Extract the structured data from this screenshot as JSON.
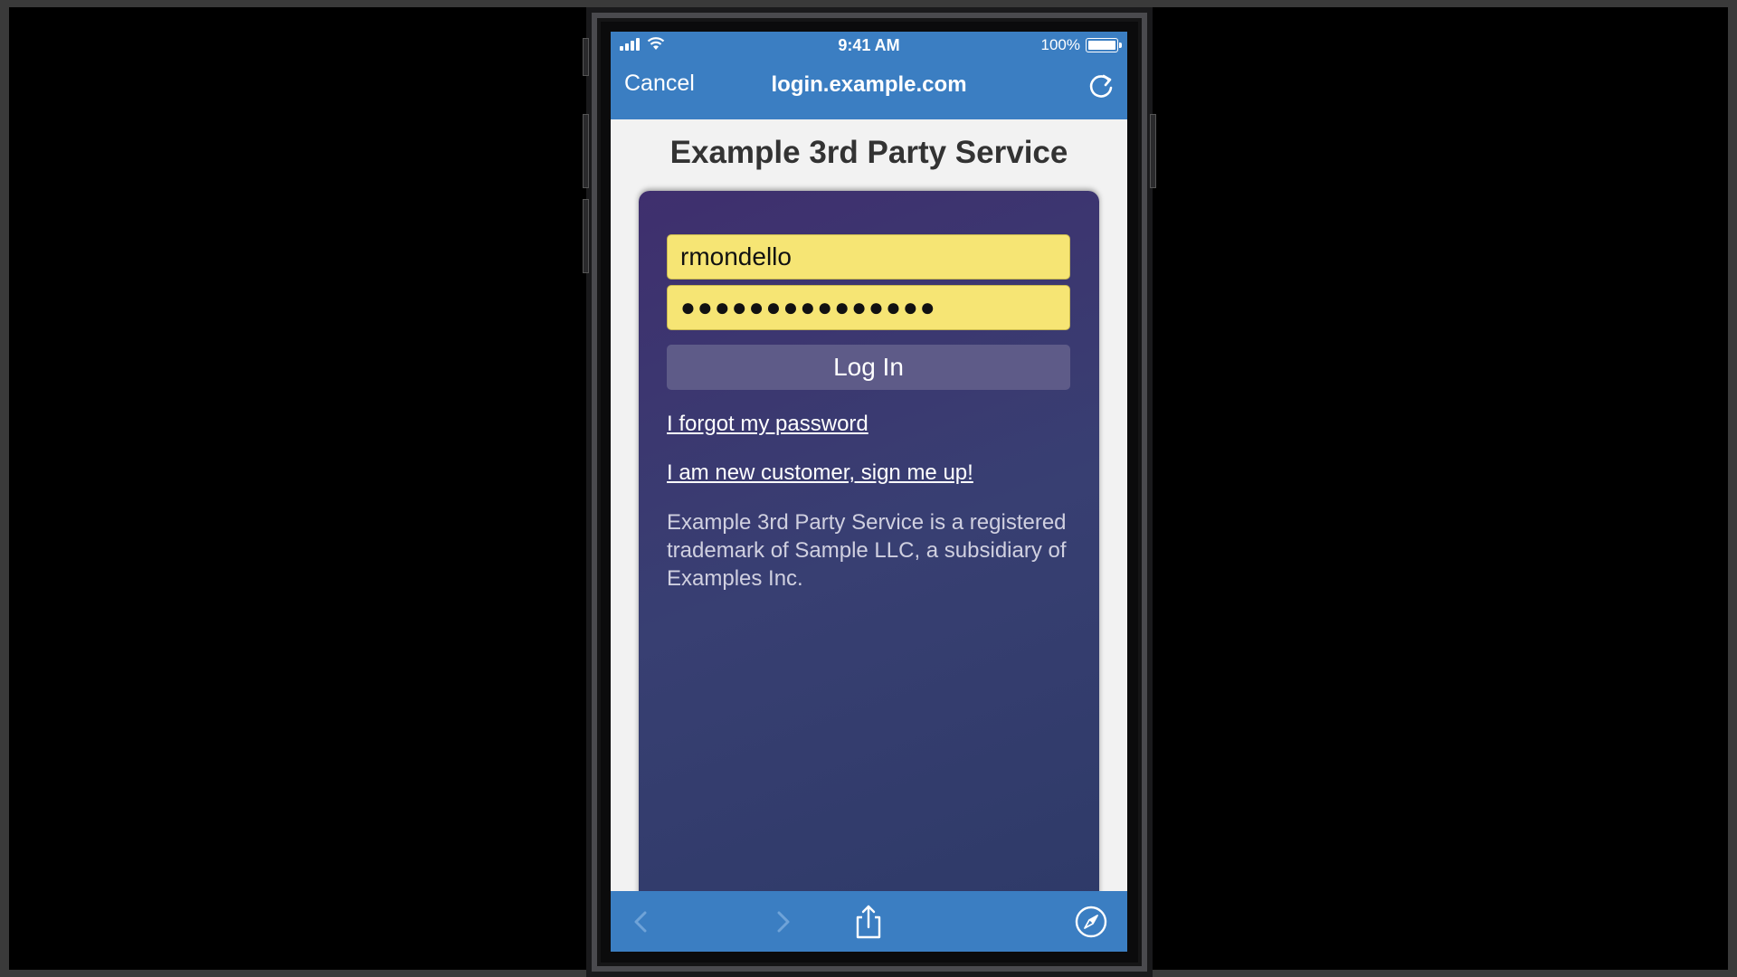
{
  "status_bar": {
    "time": "9:41 AM",
    "battery": "100%"
  },
  "nav_bar": {
    "cancel_label": "Cancel",
    "url": "login.example.com"
  },
  "page": {
    "title": "Example 3rd Party Service",
    "username_value": "rmondello",
    "password_value": "●●●●●●●●●●●●●●●",
    "login_label": "Log In",
    "forgot_link": "I forgot my password",
    "signup_link": "I am new customer, sign me up!",
    "legal_text": "Example 3rd Party Service is a registered trademark of Sample LLC, a subsidiary of Examples Inc."
  },
  "icons": {
    "signal": "cellular-signal-icon",
    "wifi": "wifi-icon",
    "battery": "battery-icon",
    "reload": "reload-icon",
    "back": "chevron-left-icon",
    "forward": "chevron-right-icon",
    "share": "share-icon",
    "compass": "safari-compass-icon"
  },
  "colors": {
    "nav_bar": "#3b7ec2",
    "field_fill": "#f6e574",
    "panel": "#383f72",
    "login_button": "#5e5b88"
  }
}
